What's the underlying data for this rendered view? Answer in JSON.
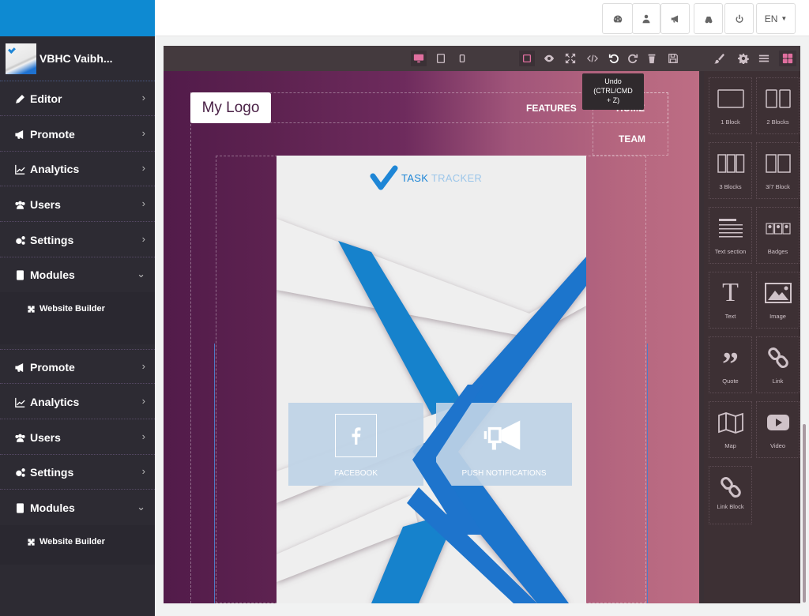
{
  "header": {
    "buttons": [
      {
        "name": "dashboard",
        "icon": "dashboard-icon"
      },
      {
        "name": "users",
        "icon": "user-icon"
      },
      {
        "name": "promote",
        "icon": "megaphone-icon"
      },
      {
        "name": "analytics",
        "icon": "binoculars-icon"
      },
      {
        "name": "logout",
        "icon": "power-icon"
      }
    ],
    "language": "EN"
  },
  "sidebar": {
    "profile_name": "VBHC Vaibh...",
    "items": [
      {
        "label": "Editor",
        "icon": "pencil-icon",
        "chevron": "›"
      },
      {
        "label": "Promote",
        "icon": "megaphone-icon",
        "chevron": "›"
      },
      {
        "label": "Analytics",
        "icon": "chart-icon",
        "chevron": "›"
      },
      {
        "label": "Users",
        "icon": "users-icon",
        "chevron": "›"
      },
      {
        "label": "Settings",
        "icon": "cogs-icon",
        "chevron": "›"
      },
      {
        "label": "Modules",
        "icon": "modules-icon",
        "chevron": "⌄"
      },
      {
        "label": "Promote",
        "icon": "megaphone-icon",
        "chevron": "›"
      },
      {
        "label": "Analytics",
        "icon": "chart-icon",
        "chevron": "›"
      },
      {
        "label": "Users",
        "icon": "users-icon",
        "chevron": "›"
      },
      {
        "label": "Settings",
        "icon": "cogs-icon",
        "chevron": "›"
      },
      {
        "label": "Modules",
        "icon": "modules-icon",
        "chevron": "⌄"
      }
    ],
    "subitems": [
      {
        "label": "Website Builder",
        "icon": "puzzle-icon"
      },
      {
        "label": "Website Builder",
        "icon": "puzzle-icon"
      }
    ]
  },
  "editor": {
    "toolbar": {
      "device_desktop": "desktop-icon",
      "device_tablet": "tablet-icon",
      "device_mobile": "mobile-icon",
      "actions": [
        "select-outline",
        "preview",
        "fullscreen",
        "code",
        "undo",
        "redo",
        "delete",
        "save"
      ]
    },
    "tooltip": {
      "line1": "Undo",
      "line2": "(CTRL/CMD",
      "line3": "+ Z)"
    },
    "panel_tabs": [
      "style-manager",
      "settings",
      "layers",
      "blocks"
    ],
    "accent_color": "#e06f9f"
  },
  "canvas": {
    "logo": "My Logo",
    "nav": [
      "FEATURES",
      "HOME",
      "TEAM"
    ],
    "app_name_a": "TASK",
    "app_name_b": " TRACKER",
    "cards": [
      {
        "caption": "FACEBOOK",
        "icon": "facebook-icon"
      },
      {
        "caption": "PUSH NOTIFICATIONS",
        "icon": "bullhorn-icon"
      }
    ]
  },
  "blocks": [
    {
      "label": "1 Block",
      "icon": "one-column-icon"
    },
    {
      "label": "2 Blocks",
      "icon": "two-column-icon"
    },
    {
      "label": "3 Blocks",
      "icon": "three-column-icon"
    },
    {
      "label": "3/7 Block",
      "icon": "three-seven-column-icon"
    },
    {
      "label": "Text section",
      "icon": "text-section-icon"
    },
    {
      "label": "Badges",
      "icon": "badges-icon"
    },
    {
      "label": "Text",
      "icon": "text-icon"
    },
    {
      "label": "Image",
      "icon": "image-icon"
    },
    {
      "label": "Quote",
      "icon": "quote-icon"
    },
    {
      "label": "Link",
      "icon": "link-icon"
    },
    {
      "label": "Map",
      "icon": "map-icon"
    },
    {
      "label": "Video",
      "icon": "video-icon"
    },
    {
      "label": "Link Block",
      "icon": "link-block-icon"
    }
  ]
}
